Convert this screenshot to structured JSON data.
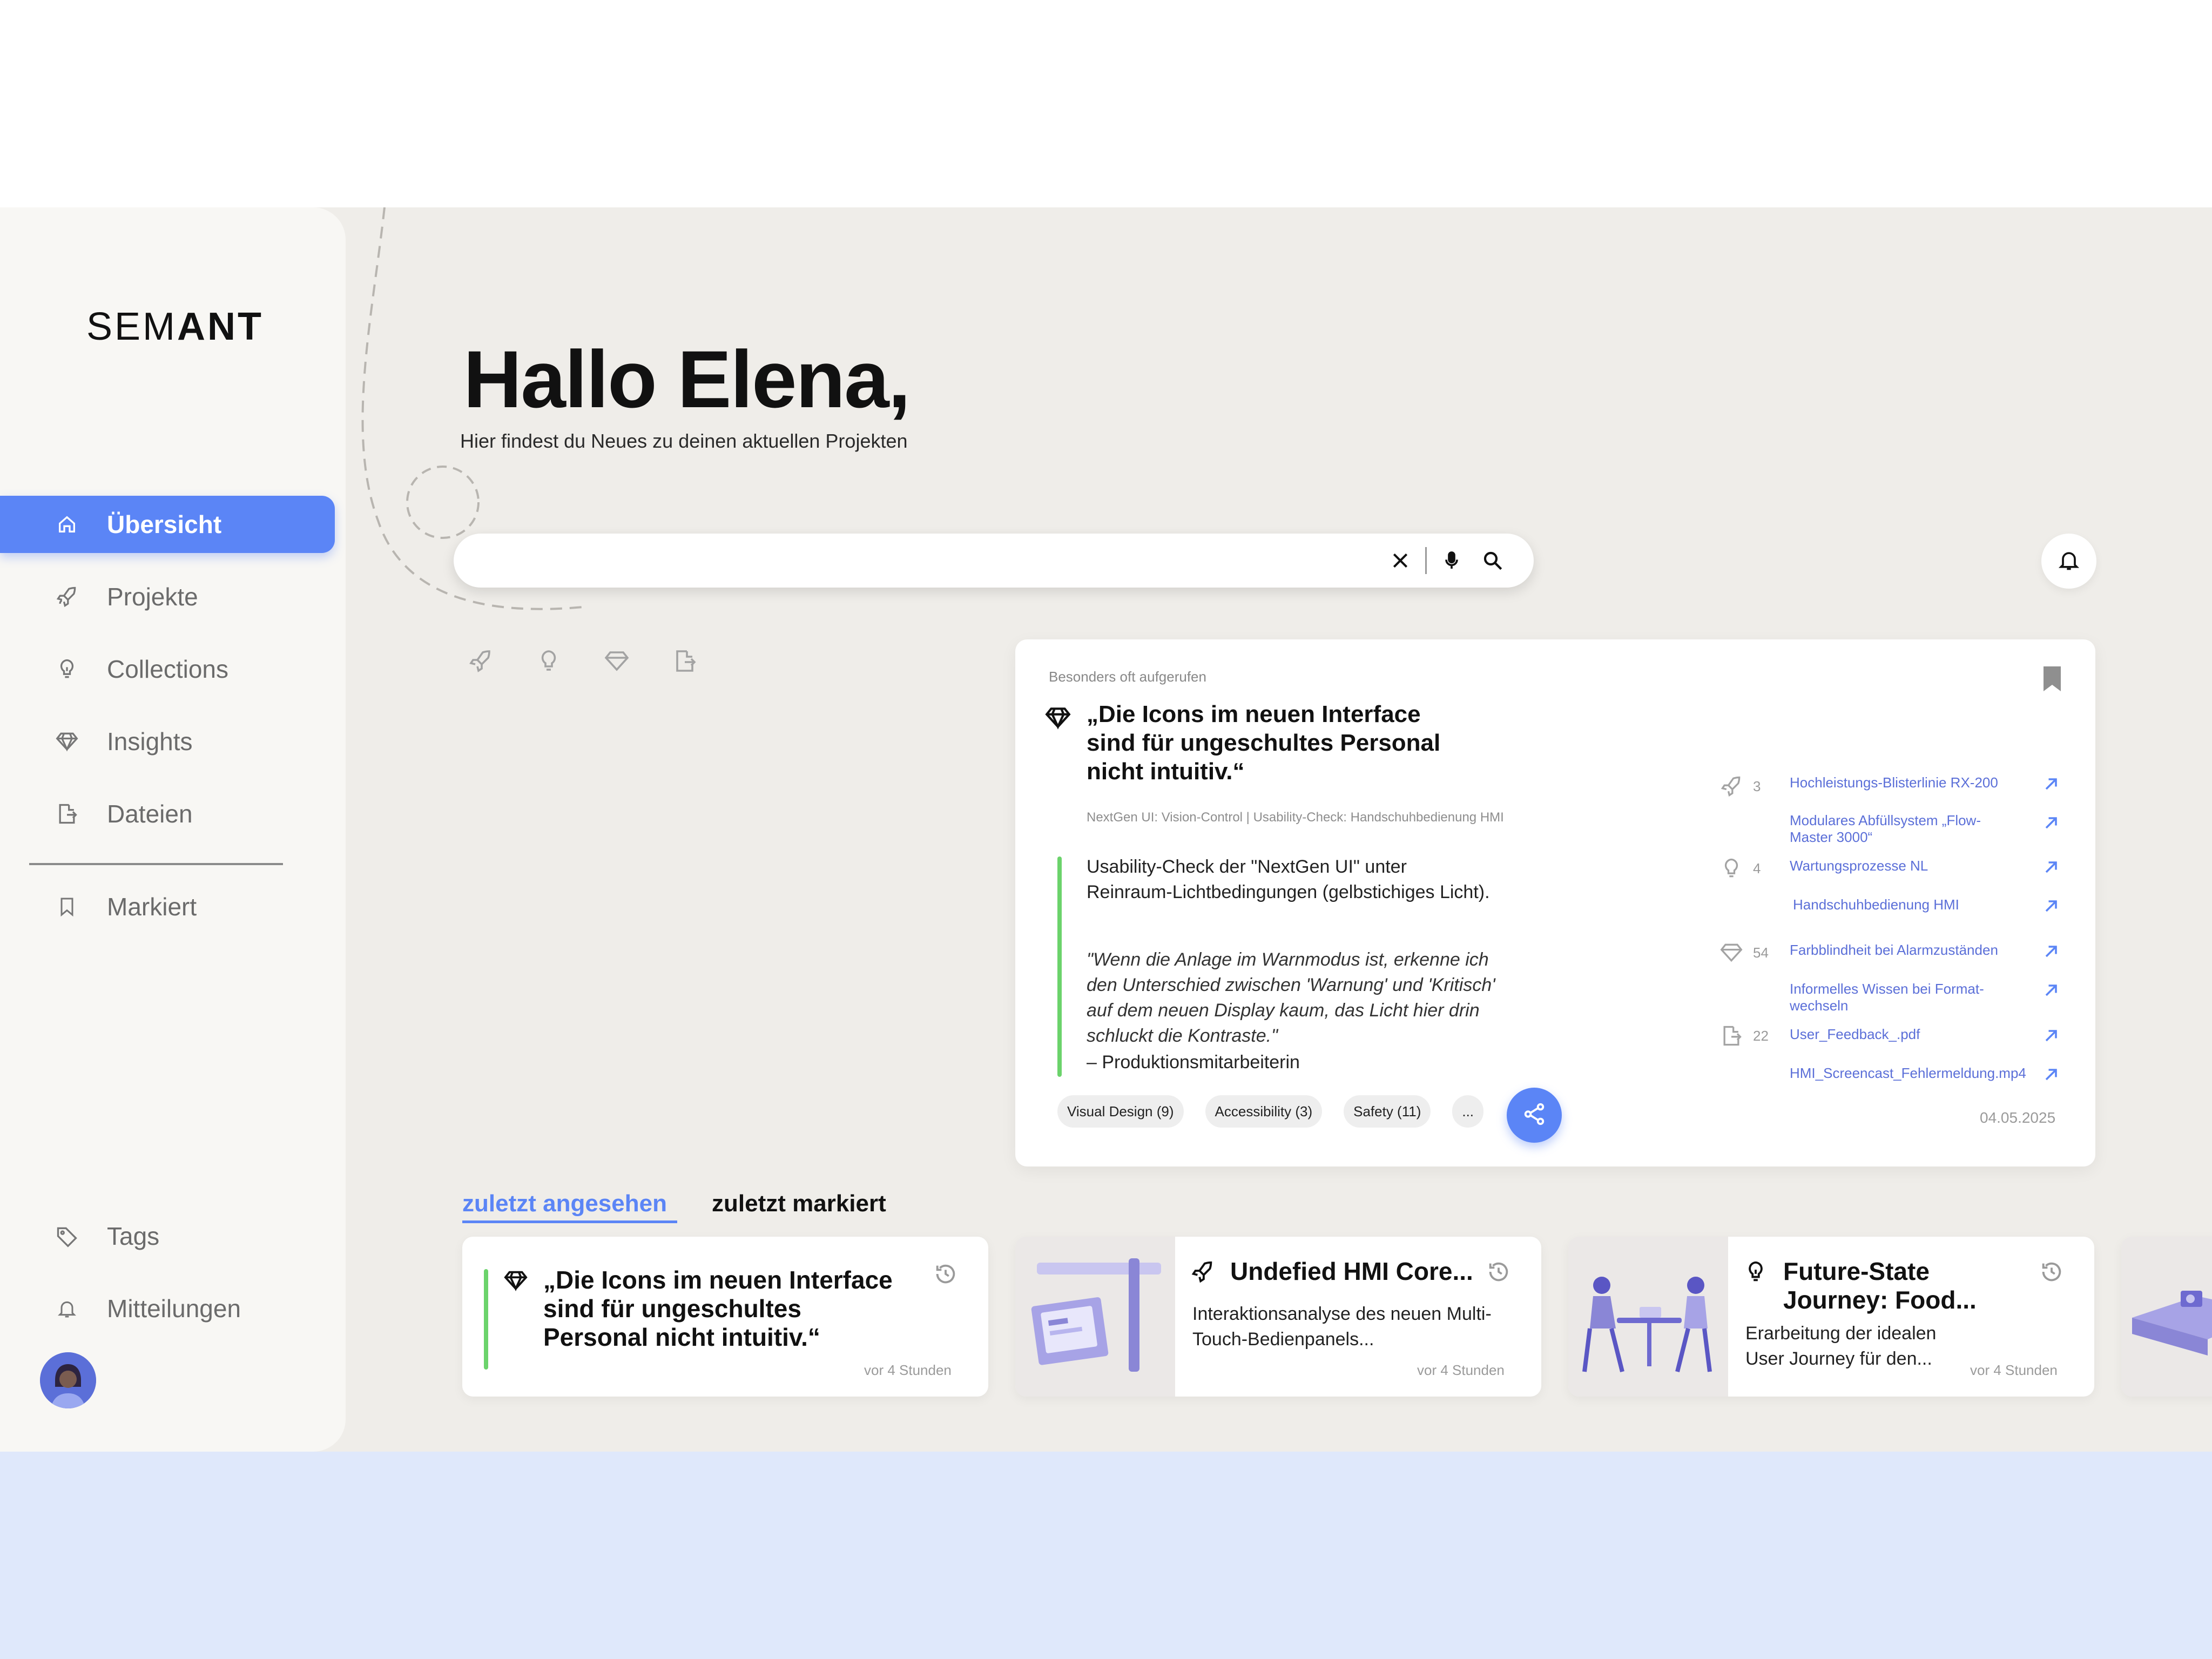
{
  "brand": {
    "logo_light": "SEM",
    "logo_bold": "ANT",
    "accent": "#5b85f6"
  },
  "sidebar": {
    "items": [
      {
        "label": "Übersicht",
        "icon": "home-icon",
        "active": true
      },
      {
        "label": "Projekte",
        "icon": "rocket-icon"
      },
      {
        "label": "Collections",
        "icon": "lightbulb-icon"
      },
      {
        "label": "Insights",
        "icon": "gem-icon"
      },
      {
        "label": "Dateien",
        "icon": "file-export-icon"
      },
      {
        "label": "Markiert",
        "icon": "bookmark-icon"
      }
    ],
    "bottom_items": [
      {
        "label": "Tags",
        "icon": "tag-icon"
      },
      {
        "label": "Mitteilungen",
        "icon": "bell-icon"
      }
    ]
  },
  "header": {
    "greeting": "Hallo Elena,",
    "subtitle": "Hier findest du Neues zu deinen aktuellen Projekten"
  },
  "search": {
    "value": "",
    "placeholder": ""
  },
  "filters": [
    "rocket-icon",
    "lightbulb-icon",
    "gem-icon",
    "file-export-icon"
  ],
  "feature": {
    "eyebrow": "Besonders oft aufgerufen",
    "title": "„Die Icons im neuen Interface sind für ungeschultes Personal nicht intuitiv.“",
    "meta": "NextGen UI: Vision-Control | Usability-Check: Handschuhbedienung HMI",
    "description": "Usability-Check der \"NextGen UI\" unter Reinraum-Lichtbedingungen (gelbstichiges Licht).",
    "quote": "\"Wenn die Anlage im Warnmodus ist, erkenne ich den Unterschied zwischen 'Warnung' und 'Kritisch' auf dem neuen Display kaum, das Licht hier drin schluckt die Kontraste.\"",
    "author": "– Produktionsmitarbeiterin",
    "tags": [
      "Visual Design (9)",
      "Accessibility (3)",
      "Safety (11)",
      "..."
    ],
    "date": "04.05.2025",
    "related": {
      "projects_count": "3",
      "collections_count": "4",
      "insights_count": "54",
      "files_count": "22",
      "links": [
        "Hochleistungs-Blisterlinie RX-200",
        "Modulares Abfüllsystem „Flow-Master 3000“",
        "Wartungsprozesse NL",
        "Handschuhbedienung HMI",
        "Farbblindheit bei Alarmzuständen",
        "Informelles Wissen bei Format-wechseln",
        "User_Feedback_.pdf",
        "HMI_Screencast_Fehlermeldung.mp4"
      ]
    }
  },
  "tabs": {
    "recent": "zuletzt angesehen",
    "marked": "zuletzt markiert"
  },
  "recent_cards": [
    {
      "title": "„Die Icons im neuen Interface sind für ungeschultes Personal nicht intuitiv.“",
      "time": "vor 4 Stunden"
    },
    {
      "title": "Undefied HMI Core...",
      "description": "Interaktionsanalyse des neuen Multi-Touch-Bedienpanels...",
      "time": "vor 4 Stunden"
    },
    {
      "title": "Future-State Journey: Food...",
      "description": "Erarbeitung der idealen User Journey für den...",
      "time": "vor 4 Stunden"
    }
  ]
}
